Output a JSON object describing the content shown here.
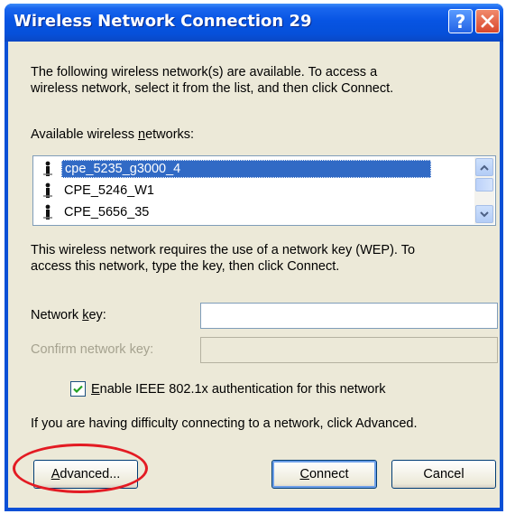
{
  "window": {
    "title": "Wireless Network Connection 29",
    "help_symbol": "?"
  },
  "intro": {
    "line1": "The following wireless network(s) are available. To access a",
    "line2": "wireless network, select it from the list, and then click Connect."
  },
  "networks": {
    "label_prefix": "Available wireless ",
    "label_key": "n",
    "label_suffix": "etworks:",
    "items": [
      {
        "name": "cpe_5235_g3000_4",
        "selected": true
      },
      {
        "name": "CPE_5246_W1",
        "selected": false
      },
      {
        "name": "CPE_5656_35",
        "selected": false
      }
    ]
  },
  "wep_message": {
    "line1": "This wireless network requires the use of a network key (WEP). To",
    "line2": "access this network, type the key, then click Connect."
  },
  "network_key": {
    "label_prefix": "Network ",
    "label_key": "k",
    "label_suffix": "ey:",
    "value": ""
  },
  "confirm_key": {
    "label": "Confirm network key:",
    "value": "",
    "disabled": true
  },
  "ieee": {
    "label_key": "E",
    "label_rest": "nable IEEE 802.1x authentication for this network",
    "checked": true
  },
  "difficulty_text": "If you are having difficulty connecting to a network, click Advanced.",
  "buttons": {
    "advanced_key": "A",
    "advanced_rest": "dvanced...",
    "connect_key": "C",
    "connect_rest": "onnect",
    "cancel": "Cancel"
  },
  "colors": {
    "title_bar": "#0754e3",
    "dialog_bg": "#ece9d8",
    "selection": "#316ac5",
    "annotation": "#e31b23"
  }
}
